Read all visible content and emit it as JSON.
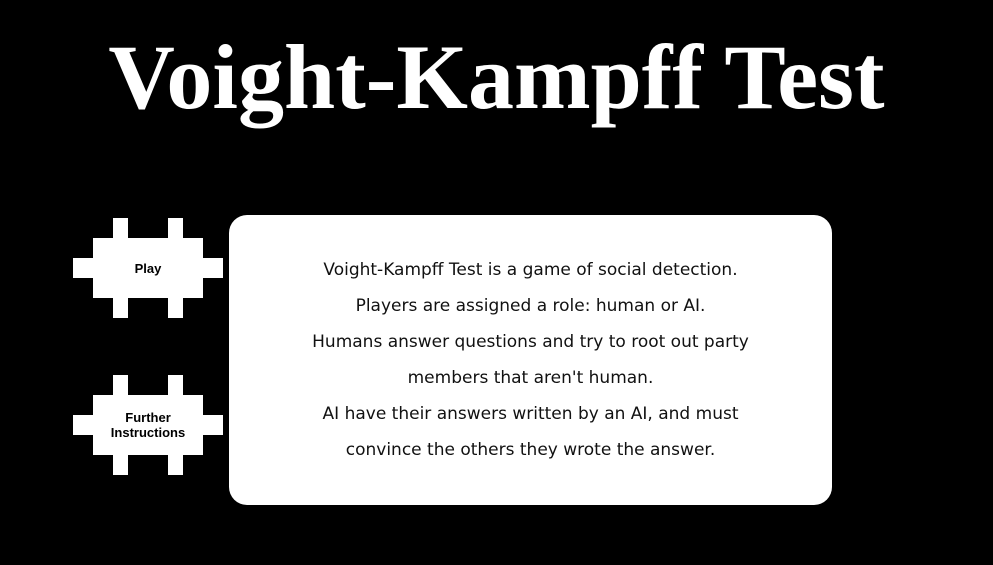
{
  "title": "Voight-Kampff Test",
  "buttons": {
    "play_label": "Play",
    "instructions_label": "Further Instructions"
  },
  "description": {
    "lines": [
      "Voight-Kampff Test is a game of social detection.",
      "Players are assigned a role: human or AI.",
      "Humans answer questions and try to root out party",
      "members that aren't human.",
      "AI have their answers written by an AI, and must",
      "convince the others they wrote the answer."
    ]
  },
  "colors": {
    "background": "#000000",
    "title": "#ffffff",
    "button_fill": "#ffffff",
    "button_text": "#000000",
    "panel": "#ffffff"
  }
}
